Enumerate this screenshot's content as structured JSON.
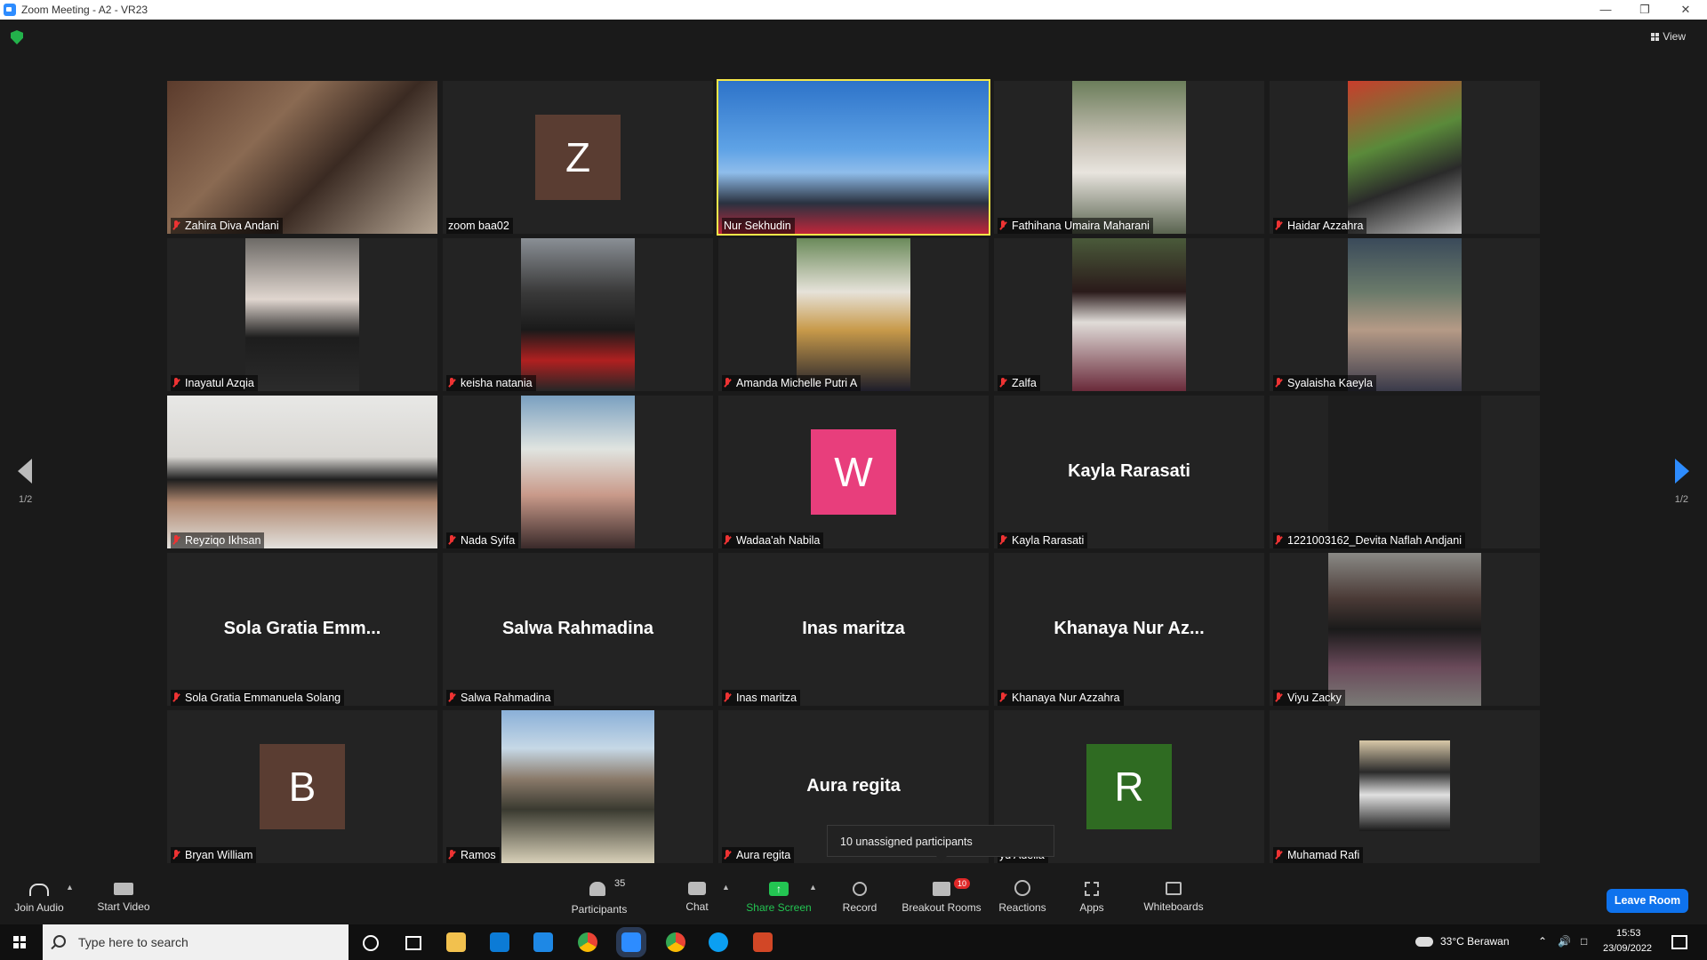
{
  "window": {
    "title": "Zoom Meeting - A2 - VR23"
  },
  "top": {
    "view_label": "View"
  },
  "pagination": {
    "left": "1/2",
    "right": "1/2"
  },
  "tiles": [
    {
      "name": "Zahira Diva Andani",
      "kind": "video"
    },
    {
      "name": "zoom baa02",
      "kind": "avatar",
      "letter": "Z",
      "color": "#5a3d32"
    },
    {
      "name": "Nur Sekhudin",
      "kind": "video",
      "active": true
    },
    {
      "name": "Fathihana Umaira Maharani",
      "kind": "video"
    },
    {
      "name": "Haidar Azzahra",
      "kind": "video"
    },
    {
      "name": "Inayatul Azqia",
      "kind": "video"
    },
    {
      "name": "keisha natania",
      "kind": "video"
    },
    {
      "name": "Amanda Michelle Putri A",
      "kind": "video"
    },
    {
      "name": "Zalfa",
      "kind": "video"
    },
    {
      "name": "Syalaisha Kaeyla",
      "kind": "video"
    },
    {
      "name": "Reyziqo Ikhsan",
      "kind": "video"
    },
    {
      "name": "Nada Syifa",
      "kind": "video"
    },
    {
      "name": "Wadaa'ah Nabila",
      "kind": "avatar",
      "letter": "W",
      "color": "#e83e7c"
    },
    {
      "name": "Kayla Rarasati",
      "kind": "text",
      "display": "Kayla Rarasati"
    },
    {
      "name": "1221003162_Devita Naflah Andjani",
      "kind": "dark"
    },
    {
      "name": "Sola Gratia Emmanuela Solang",
      "kind": "text",
      "display": "Sola Gratia Emm..."
    },
    {
      "name": "Salwa Rahmadina",
      "kind": "text",
      "display": "Salwa Rahmadina"
    },
    {
      "name": "Inas maritza",
      "kind": "text",
      "display": "Inas maritza"
    },
    {
      "name": "Khanaya Nur Azzahra",
      "kind": "text",
      "display": "Khanaya Nur Az..."
    },
    {
      "name": "Viyu Zacky",
      "kind": "video"
    },
    {
      "name": "Bryan William",
      "kind": "avatar",
      "letter": "B",
      "color": "#5a3d32"
    },
    {
      "name": "Ramos",
      "kind": "video"
    },
    {
      "name": "Aura regita",
      "kind": "text",
      "display": "Aura regita"
    },
    {
      "name": "yu Adelia",
      "kind": "avatar",
      "letter": "R",
      "color": "#2f6b22"
    },
    {
      "name": "Muhamad Rafi",
      "kind": "video"
    }
  ],
  "tooltip": "10 unassigned participants",
  "toolbar": {
    "join_audio": "Join Audio",
    "start_video": "Start Video",
    "participants": "Participants",
    "participants_count": "35",
    "chat": "Chat",
    "share_screen": "Share Screen",
    "record": "Record",
    "breakout_rooms": "Breakout Rooms",
    "breakout_badge": "10",
    "reactions": "Reactions",
    "apps": "Apps",
    "whiteboards": "Whiteboards",
    "leave": "Leave Room"
  },
  "taskbar": {
    "search_placeholder": "Type here to search",
    "weather": "33°C  Berawan",
    "time": "15:53",
    "date": "23/09/2022"
  }
}
